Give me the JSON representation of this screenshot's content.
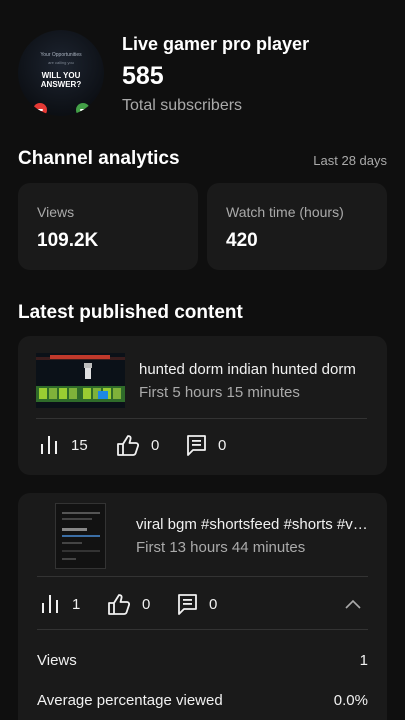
{
  "channel": {
    "name": "Live gamer pro player",
    "subscribers": "585",
    "subscribers_label": "Total subscribers",
    "avatar": {
      "line1": "Your Opportunities",
      "line2": "are calling you",
      "headline1": "WILL YOU",
      "headline2": "ANSWER?"
    }
  },
  "analytics": {
    "title": "Channel analytics",
    "range": "Last 28 days",
    "cards": [
      {
        "label": "Views",
        "value": "109.2K"
      },
      {
        "label": "Watch time (hours)",
        "value": "420"
      }
    ]
  },
  "latest": {
    "title": "Latest published content",
    "items": [
      {
        "title": "hunted dorm indian hunted dorm",
        "subtitle": "First 5 hours 15 minutes",
        "views": "15",
        "likes": "0",
        "comments": "0"
      },
      {
        "title": "viral bgm #shortsfeed #shorts #viral",
        "subtitle": "First 13 hours 44 minutes",
        "views": "1",
        "likes": "0",
        "comments": "0",
        "details": [
          {
            "label": "Views",
            "value": "1"
          },
          {
            "label": "Average percentage viewed",
            "value": "0.0%"
          }
        ]
      }
    ]
  },
  "icons": {
    "views": "bar-chart-icon",
    "likes": "thumbs-up-icon",
    "comments": "comment-icon",
    "collapse": "chevron-up-icon"
  }
}
